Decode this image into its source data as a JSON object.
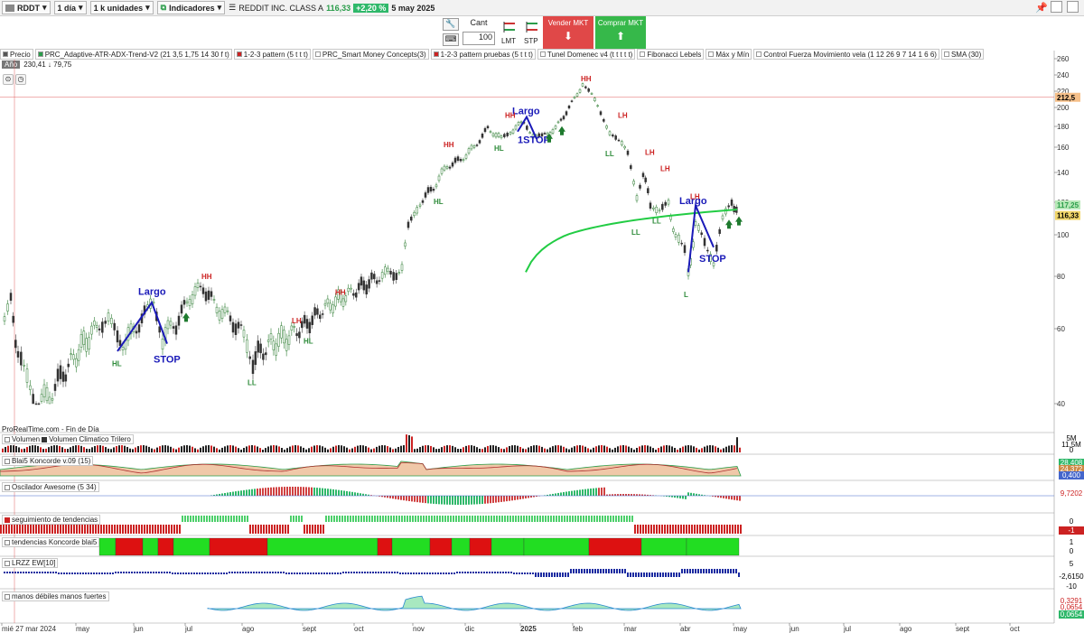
{
  "toolbar": {
    "symbol": "RDDT",
    "timeframe": "1 día",
    "units": "1 k unidades",
    "indicators_label": "Indicadores",
    "instrument_name": "REDDIT INC. CLASS A",
    "last_price": "116,33",
    "change_pct": "+2,20 %",
    "date": "5 may 2025"
  },
  "order": {
    "qty_label": "Cant",
    "qty_value": "100",
    "lmt_label": "LMT",
    "stp_label": "STP",
    "sell_label": "Vender MKT",
    "buy_label": "Comprar MKT"
  },
  "legend": [
    "Precio",
    "PRC_Adaptive-ATR-ADX-Trend-V2 (21 3,5 1,75 14 30 f t)",
    "1-2-3 pattern (5 t t t)",
    "PRC_Smart Money Concepts(3)",
    "1-2-3 pattern pruebas (5 t t t)",
    "Tunel Domenec v4 (t t t t t)",
    "Fibonacci Lebels",
    "Máx y Mín",
    "Control Fuerza Movimiento vela (1 12 26 9 7 14 1 6 6)",
    "SMA (30)"
  ],
  "period": {
    "label": "Año",
    "value": "230,41 ↓ 79,75"
  },
  "footer_left": "ProRealTime.com - Fin de Día",
  "panels": {
    "volume": {
      "title1": "Volumen",
      "title2": "Volumen Climatico Trilero",
      "r1": "5M",
      "r2": "11,5M",
      "r3": "0"
    },
    "koncorde": {
      "title": "Blai5 Koncorde v.09 (15)",
      "r1": "28,408",
      "r2": "24,372",
      "r3": "0,400"
    },
    "awesome": {
      "title": "Oscilador Awesome (5 34)",
      "r1": "9,7202"
    },
    "trend": {
      "title": "seguimiento de tendencias",
      "r1": "0",
      "r2": "-1"
    },
    "koncorde_trend": {
      "title": "tendencias Koncorde blai5",
      "r1": "1",
      "r2": "0"
    },
    "lrzz": {
      "title": "LRZZ EW[10]",
      "r1": "5",
      "r2": "-2,6150",
      "r3": "-10"
    },
    "hands": {
      "title": "manos débiles  manos fuertes",
      "r1": "0,3291",
      "r2": "0,0654",
      "r3": "0,0654"
    }
  },
  "price_axis": [
    "260",
    "240",
    "220",
    "200",
    "180",
    "160",
    "140",
    "120",
    "100",
    "80",
    "60",
    "40"
  ],
  "price_tags": {
    "high": "212,5",
    "upper": "117,25",
    "last": "116,33"
  },
  "time_axis": [
    "mié 27 mar 2024",
    "may",
    "jun",
    "jul",
    "ago",
    "sept",
    "oct",
    "nov",
    "dic",
    "2025",
    "feb",
    "mar",
    "abr",
    "may",
    "jun",
    "jul",
    "ago",
    "sept",
    "oct"
  ],
  "chart_annotations": {
    "largo": "Largo",
    "stop": "STOP",
    "stop2": "1STOP",
    "hh": "HH",
    "lh": "LH",
    "hl": "HL",
    "ll": "LL",
    "l": "L"
  },
  "colors": {
    "bull": "#2e8b3a",
    "bear": "#cc2222",
    "sma": "#22cc44",
    "pattern": "#1a1ab8",
    "accent_green": "#2fb86a"
  }
}
